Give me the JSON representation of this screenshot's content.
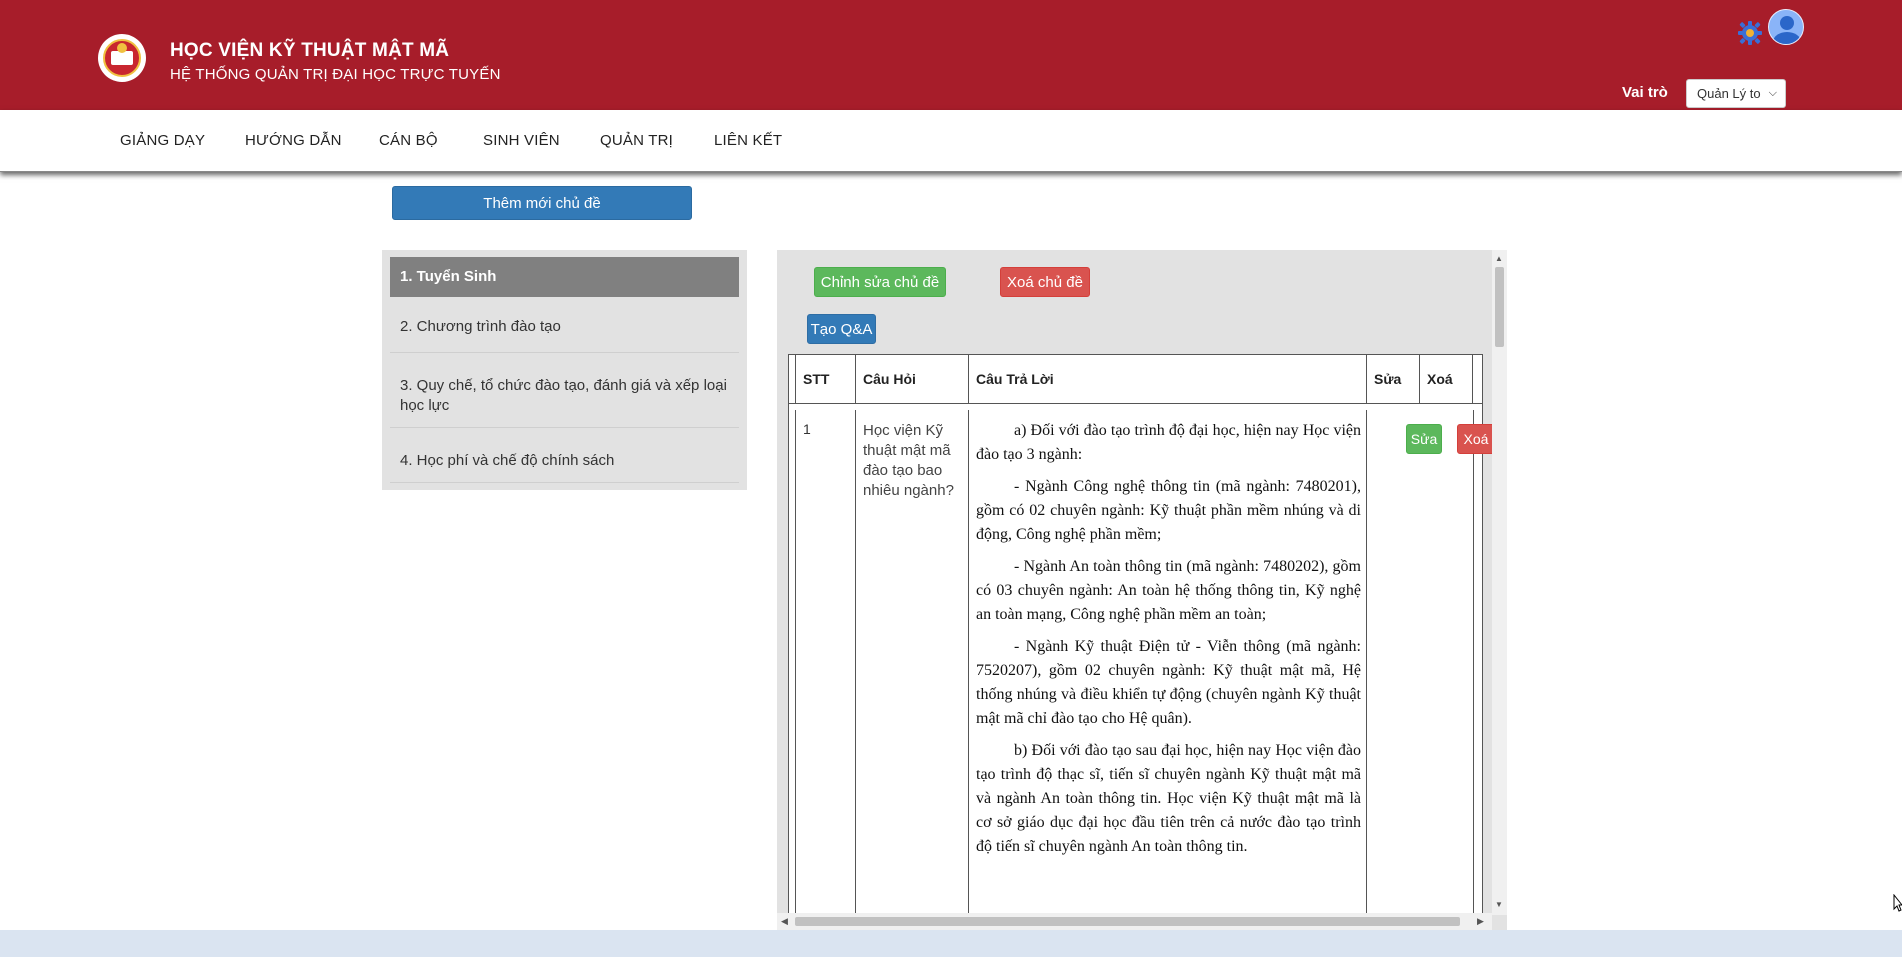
{
  "header": {
    "title": "HỌC VIỆN KỸ THUẬT MẬT MÃ",
    "subtitle": "HỆ THỐNG QUẢN TRỊ ĐẠI HỌC TRỰC TUYẾN",
    "role_label": "Vai trò",
    "role_value": "Quản Lý to",
    "colors": {
      "brand": "#a71d2a"
    }
  },
  "nav": {
    "items": [
      "GIẢNG DẠY",
      "HƯỚNG DẪN",
      "CÁN BỘ",
      "SINH VIÊN",
      "QUẢN TRỊ",
      "LIÊN KẾT"
    ]
  },
  "toolbar": {
    "add_topic_label": "Thêm mới chủ đề"
  },
  "topics": [
    {
      "label": "1. Tuyển Sinh",
      "active": true
    },
    {
      "label": "2. Chương trình đào tạo",
      "active": false
    },
    {
      "label": "3. Quy chế, tổ chức đào tạo, đánh giá và xếp loại học lực",
      "active": false
    },
    {
      "label": "4. Học phí và chế độ chính sách",
      "active": false
    }
  ],
  "content": {
    "edit_topic_label": "Chỉnh sửa chủ đề",
    "delete_topic_label": "Xoá chủ đề",
    "create_qa_label": "Tạo Q&A",
    "table": {
      "headers": [
        "STT",
        "Câu Hỏi",
        "Câu Trả Lời",
        "Sửa",
        "Xoá"
      ],
      "rows": [
        {
          "stt": "1",
          "question": "Học viện Kỹ thuật mật mã đào tạo bao nhiêu ngành?",
          "answer": [
            "a) Đối với đào tạo trình độ đại học, hiện nay Học viện đào tạo 3 ngành:",
            "- Ngành Công nghệ thông tin (mã ngành: 7480201), gồm có 02 chuyên ngành: Kỹ thuật phần mềm nhúng và di động, Công nghệ phần mềm;",
            "- Ngành An toàn thông tin (mã ngành: 7480202), gồm có 03 chuyên ngành: An toàn hệ thống thông tin, Kỹ nghệ an toàn mạng, Công nghệ phần mềm an toàn;",
            "- Ngành Kỹ thuật Điện tử - Viễn thông (mã ngành: 7520207), gồm 02 chuyên ngành: Kỹ thuật mật mã, Hệ thống nhúng và điều khiển tự động (chuyên ngành Kỹ thuật mật mã chỉ đào tạo cho Hệ quân).",
            "b) Đối với đào tạo sau đại học, hiện nay Học viện đào tạo trình độ thạc sĩ, tiến sĩ chuyên ngành Kỹ thuật mật mã và ngành An toàn thông tin. Học viện Kỹ thuật mật mã là cơ sở giáo dục đại học đầu tiên trên cả nước đào tạo trình độ tiến sĩ chuyên ngành An toàn thông tin."
          ],
          "edit_label": "Sửa",
          "delete_label": "Xoá"
        }
      ]
    }
  }
}
